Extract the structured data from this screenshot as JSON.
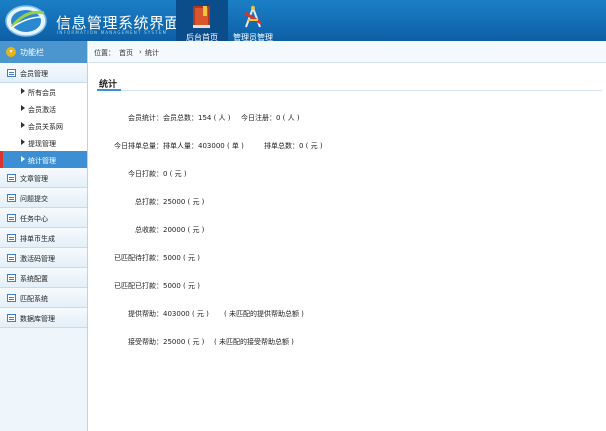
{
  "header": {
    "title": "信息管理系统界面",
    "subtitle": "INFORMATION MANAGEMENT SYSTEM",
    "nav": [
      {
        "label": "后台首页"
      },
      {
        "label": "管理员管理"
      }
    ]
  },
  "sidebar": {
    "heading": "功能栏",
    "groups": [
      {
        "label": "会员管理"
      },
      {
        "label": "文章管理"
      },
      {
        "label": "问题提交"
      },
      {
        "label": "任务中心"
      },
      {
        "label": "排单币生成"
      },
      {
        "label": "激活码管理"
      },
      {
        "label": "系统配置"
      },
      {
        "label": "匹配系统"
      },
      {
        "label": "数据库管理"
      }
    ],
    "subitems": [
      {
        "label": "所有会员"
      },
      {
        "label": "会员激活"
      },
      {
        "label": "会员关系网"
      },
      {
        "label": "提现管理"
      },
      {
        "label": "统计管理"
      }
    ]
  },
  "breadcrumb": {
    "prefix": "位置：",
    "home": "首页",
    "sep": "›",
    "current": "统计"
  },
  "page": {
    "title": "统计",
    "rows": [
      {
        "label": "会员统计：",
        "value": "会员总数：154 ( 人 )",
        "extra": "今日注册：0 ( 人 )"
      },
      {
        "label": "今日排单总量：",
        "value": "排单人量：403000 ( 单 )",
        "extra": "排单总数：0 ( 元 )"
      },
      {
        "label": "今日打款：",
        "value": "0 ( 元 )",
        "extra": ""
      },
      {
        "label": "总打款：",
        "value": "25000 ( 元 )",
        "extra": ""
      },
      {
        "label": "总收款：",
        "value": "20000 ( 元 )",
        "extra": ""
      },
      {
        "label": "已匹配待打款：",
        "value": "5000 ( 元 )",
        "extra": ""
      },
      {
        "label": "已匹配已打款：",
        "value": "5000 ( 元 )",
        "extra": ""
      },
      {
        "label": "提供帮助：",
        "value": "403000 ( 元 )",
        "extra": "( 未匹配的提供帮助总额 )"
      },
      {
        "label": "接受帮助：",
        "value": "25000 ( 元 )",
        "extra": "( 未匹配的接受帮助总额 )"
      }
    ]
  },
  "colors": {
    "header": "#1b7fc6",
    "sidebar_head": "#4b96cf",
    "active": "#3d8fd3",
    "active_marker": "#d9342b"
  }
}
